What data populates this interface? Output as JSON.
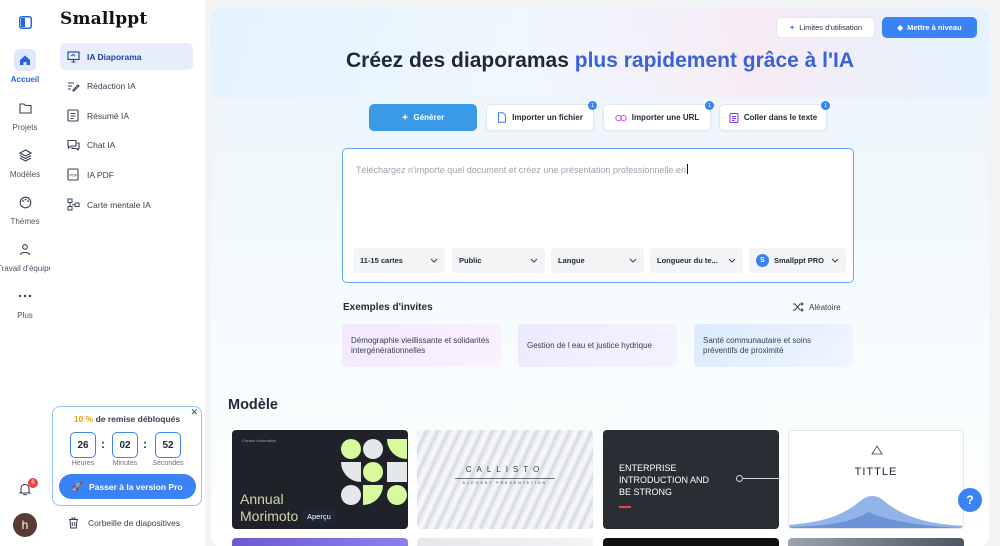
{
  "app": {
    "logo": "Smallppt"
  },
  "rail": {
    "items": [
      {
        "label": "Accueil",
        "icon": "home-icon",
        "active": true
      },
      {
        "label": "Projets",
        "icon": "folder-icon"
      },
      {
        "label": "Modèles",
        "icon": "layers-icon"
      },
      {
        "label": "Thèmes",
        "icon": "palette-icon"
      },
      {
        "label": "Travail d'équipe",
        "icon": "team-icon"
      },
      {
        "label": "Plus",
        "icon": "more-icon"
      }
    ],
    "notifications_count": "6",
    "avatar_letter": "h"
  },
  "sidebar": {
    "items": [
      {
        "label": "IA Diaporama",
        "icon": "presentation-icon",
        "active": true
      },
      {
        "label": "Rédaction IA",
        "icon": "pen-icon"
      },
      {
        "label": "Résumé IA",
        "icon": "summary-icon"
      },
      {
        "label": "Chat IA",
        "icon": "chat-icon"
      },
      {
        "label": "IA PDF",
        "icon": "pdf-icon"
      },
      {
        "label": "Carte mentale IA",
        "icon": "mindmap-icon"
      }
    ],
    "trash_label": "Corbeille de diapositives"
  },
  "promo": {
    "percent": "10 %",
    "title_rest": " de remise débloqués",
    "hours": "26",
    "minutes": "02",
    "seconds": "52",
    "hours_label": "Heures",
    "minutes_label": "Minutes",
    "seconds_label": "Secondes",
    "button": "Passer à la version Pro"
  },
  "header": {
    "limits": "Limites d'utilisation",
    "upgrade": "Mettre à niveau"
  },
  "hero": {
    "part1": "Créez des diaporamas ",
    "highlight": "plus rapidement grâce à l'IA"
  },
  "tabs": [
    {
      "label": "Générer",
      "icon": "sparkle-icon"
    },
    {
      "label": "Importer un fichier",
      "icon": "file-icon",
      "badge": "1"
    },
    {
      "label": "Importer une URL",
      "icon": "link-icon",
      "badge": "1"
    },
    {
      "label": "Coller dans le texte",
      "icon": "paste-icon",
      "badge": "1"
    }
  ],
  "prompt": {
    "placeholder": "Téléchargez n'importe quel document et créez une présentation professionnelle en",
    "selects": [
      "11-15 cartes",
      "Public",
      "Langue",
      "Longueur du te...",
      "Smallppt PRO"
    ]
  },
  "examples": {
    "title": "Exemples d'invites",
    "random": "Aléatoire",
    "items": [
      "Démographie vieillissante et solidarités intergénérationnelles",
      "Gestion de l eau et justice hydrique",
      "Santé communautaire et soins préventifs de proximité"
    ]
  },
  "models": {
    "title": "Modèle",
    "cards": [
      {
        "small": "Creator information",
        "title1": "Annual",
        "title2": "Morimoto",
        "preview": "Aperçu"
      },
      {
        "title": "CALLISTO",
        "subtitle": "ELEGANT PRESENTATION"
      },
      {
        "line1": "ENTERPRISE",
        "line2": "INTRODUCTION AND",
        "line3": "BE STRONG"
      },
      {
        "title": "TITTLE"
      }
    ]
  },
  "help": "?"
}
